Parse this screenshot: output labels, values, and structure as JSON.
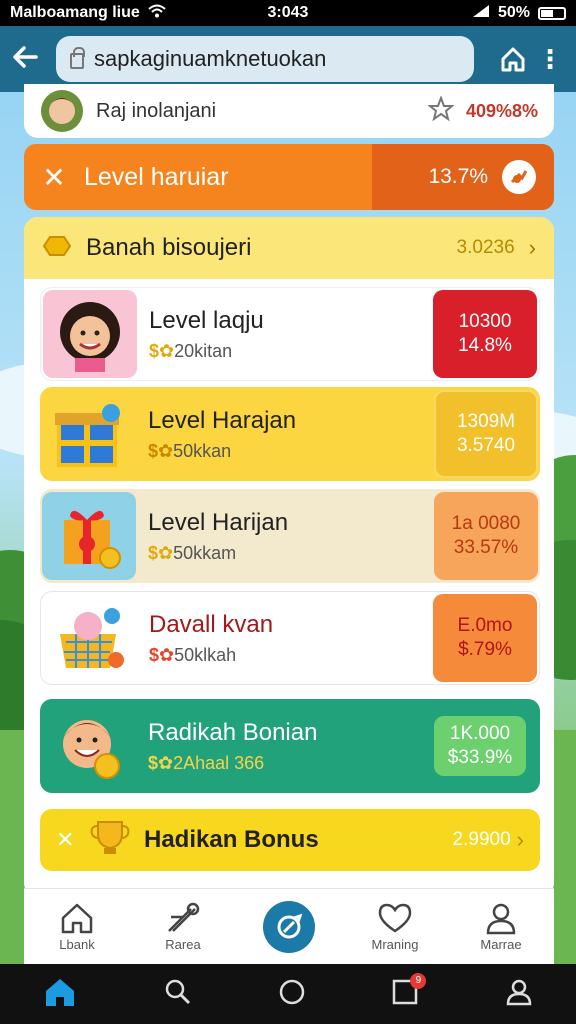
{
  "status_bar": {
    "carrier": "Malboamang liue",
    "time": "3:043",
    "battery": "50%"
  },
  "browser": {
    "url": "sapkaginuamknetuokan"
  },
  "top_card": {
    "name": "Raj inolanjani",
    "percent": "409%8%"
  },
  "orange_banner": {
    "title": "Level haruiar",
    "value": "13.7%"
  },
  "main_card": {
    "title": "Banah bisoujeri",
    "value": "3.0236",
    "rows": [
      {
        "title": "Level laqju",
        "subtitle": "20kitan",
        "box_line1": "10300",
        "box_line2": "14.8%",
        "box_color": "#d81f2a"
      },
      {
        "title": "Level Harajan",
        "subtitle": "50kkan",
        "box_line1": "1309M",
        "box_line2": "3.5740",
        "box_color": "#f4c430"
      },
      {
        "title": "Level Harijan",
        "subtitle": "50kkam",
        "box_line1": "1a 0080",
        "box_line2": "33.57%",
        "box_color": "#f6a55a"
      },
      {
        "title": "Davall kvan",
        "subtitle": "50klkah",
        "box_line1": "E.0mo",
        "box_line2": "$.79%",
        "box_color": "#f58a3a"
      },
      {
        "title": "Radikah Bonian",
        "subtitle": "2Ahaal 366",
        "box_line1": "1K.000",
        "box_line2": "$33.9%",
        "box_color": "#6cd06e"
      }
    ],
    "bonus_bar": {
      "title": "Hadikan Bonus",
      "value": "2.9900"
    }
  },
  "bottom_nav": [
    {
      "label": "Lbank",
      "icon": "home-outline-icon"
    },
    {
      "label": "Rarea",
      "icon": "ruler-compass-icon"
    },
    {
      "label": "",
      "icon": "refresh-center-icon"
    },
    {
      "label": "Mraning",
      "icon": "heart-chat-icon"
    },
    {
      "label": "Marrae",
      "icon": "profile-icon"
    }
  ],
  "system_nav": {
    "badge": "9"
  },
  "colors": {
    "url_bar": "#1f6b8e",
    "orange": "#f5841f",
    "yellow_head": "#fbe67a",
    "green_row": "#22a27a"
  }
}
